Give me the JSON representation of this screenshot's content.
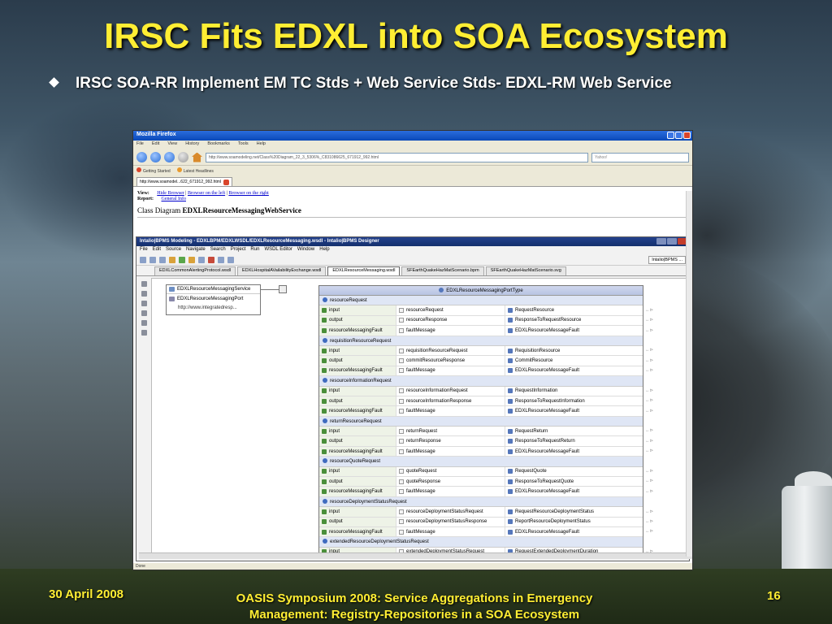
{
  "slide": {
    "title": "IRSC Fits EDXL into SOA Ecosystem",
    "bullet": "IRSC SOA-RR Implement EM TC Stds + Web Service Stds- EDXL-RM Web Service",
    "footer_date": "30 April 2008",
    "footer_text_line1": "OASIS Symposium 2008: Service Aggregations in Emergency",
    "footer_text_line2": "Management: Registry-Repositories in a SOA Ecosystem",
    "page_number": "16"
  },
  "browser": {
    "window_title": "Mozilla Firefox",
    "menu": [
      "File",
      "Edit",
      "View",
      "History",
      "Bookmarks",
      "Tools",
      "Help"
    ],
    "url": "http://www.soamodeling.net/Class%20Diagram_22_3_5306%_C831086625_671912_992.html",
    "search_placeholder": "Yahoo!",
    "bookmarks": [
      "Getting Started",
      "Latest Headlines"
    ],
    "tab_label": "http://www.soamodel...622_671912_992.html",
    "status": "Done"
  },
  "page": {
    "view_label": "View:",
    "view_links": [
      "Hide Browser",
      "Browser on the left",
      "Browser on the right"
    ],
    "report_label": "Report:",
    "report_link": "General Info",
    "diagram_prefix": "Class Diagram",
    "diagram_name": "EDXLResourceMessagingWebService"
  },
  "eclipse": {
    "title": "Intalio|BPMS Modeling - EDXLBPM/EDXLWSDL/EDXLResourceMessaging.wsdl - Intalio|BPMS Designer",
    "menu": [
      "File",
      "Edit",
      "Source",
      "Navigate",
      "Search",
      "Project",
      "Run",
      "WSDL Editor",
      "Window",
      "Help"
    ],
    "perspective": "Intalio|BPMS ...",
    "tabs": [
      "EDXLCommonAlertingProtocol.wsdl",
      "EDXLHospitalAVailabilityExchange.wsdl",
      "EDXLResourceMessaging.wsdl",
      "SFEarthQuakeHazMatScenario.bpm",
      "SFEarthQuakeHazMatScenario.svg"
    ],
    "active_tab": 2
  },
  "service": {
    "name": "EDXLResourceMessagingService",
    "port": "EDXLResourceMessagingPort",
    "address": "http://www.integratedresp..."
  },
  "port_type": {
    "name": "EDXLResourceMessagingPortType",
    "operations": [
      {
        "name": "resourceRequest",
        "rows": [
          [
            "input",
            "resourceRequest",
            "RequestResource"
          ],
          [
            "output",
            "resourceResponse",
            "ResponseToRequestResource"
          ],
          [
            "resourceMessagingFault",
            "faultMessage",
            "EDXLResourceMessageFault"
          ]
        ]
      },
      {
        "name": "requisitionResourceRequest",
        "rows": [
          [
            "input",
            "requisitionResourceRequest",
            "RequisitionResource"
          ],
          [
            "output",
            "commitResourceResponse",
            "CommitResource"
          ],
          [
            "resourceMessagingFault",
            "faultMessage",
            "EDXLResourceMessageFault"
          ]
        ]
      },
      {
        "name": "resourceInformationRequest",
        "rows": [
          [
            "input",
            "resourceInformationRequest",
            "RequestInformation"
          ],
          [
            "output",
            "resourceInformationResponse",
            "ResponseToRequestInformation"
          ],
          [
            "resourceMessagingFault",
            "faultMessage",
            "EDXLResourceMessageFault"
          ]
        ]
      },
      {
        "name": "returnResourceRequest",
        "rows": [
          [
            "input",
            "returnRequest",
            "RequestReturn"
          ],
          [
            "output",
            "returnResponse",
            "ResponseToRequestReturn"
          ],
          [
            "resourceMessagingFault",
            "faultMessage",
            "EDXLResourceMessageFault"
          ]
        ]
      },
      {
        "name": "resourceQuoteRequest",
        "rows": [
          [
            "input",
            "quoteRequest",
            "RequestQuote"
          ],
          [
            "output",
            "quoteResponse",
            "ResponseToRequestQuote"
          ],
          [
            "resourceMessagingFault",
            "faultMessage",
            "EDXLResourceMessageFault"
          ]
        ]
      },
      {
        "name": "resourceDeploymentStatusRequest",
        "rows": [
          [
            "input",
            "resourceDeploymentStatusRequest",
            "RequestResourceDeploymentStatus"
          ],
          [
            "output",
            "resourceDeploymentStatusResponse",
            "ReportResourceDeploymentStatus"
          ],
          [
            "resourceMessagingFault",
            "faultMessage",
            "EDXLResourceMessageFault"
          ]
        ]
      },
      {
        "name": "extendedResourceDeploymentStatusRequest",
        "rows": [
          [
            "input",
            "extendedDeploymentStatusRequest",
            "RequestExtendedDeploymentDuration"
          ]
        ]
      }
    ]
  }
}
